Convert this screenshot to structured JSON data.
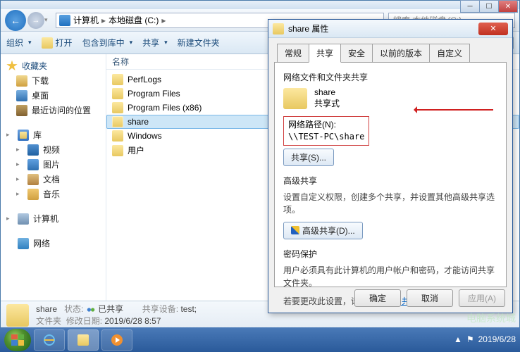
{
  "window": {
    "min_glyph": "─",
    "max_glyph": "☐",
    "close_glyph": "✕"
  },
  "nav": {
    "back_glyph": "←",
    "fwd_glyph": "→",
    "drop_glyph": "▾",
    "breadcrumb": {
      "seg1": "计算机",
      "seg2": "本地磁盘 (C:)"
    },
    "search_placeholder": "搜索 本地磁盘 (C:)"
  },
  "toolbar": {
    "organize": "组织",
    "open": "打开",
    "include": "包含到库中",
    "share": "共享",
    "newfolder": "新建文件夹",
    "view_glyph": "☰",
    "preview_glyph": "▭",
    "help_glyph": "?"
  },
  "sidebar": {
    "favorites": "收藏夹",
    "downloads": "下载",
    "desktop": "桌面",
    "recent": "最近访问的位置",
    "libraries": "库",
    "videos": "视频",
    "pictures": "图片",
    "documents": "文档",
    "music": "音乐",
    "computer": "计算机",
    "network": "网络"
  },
  "content": {
    "col_name": "名称",
    "items": [
      {
        "name": "PerfLogs"
      },
      {
        "name": "Program Files"
      },
      {
        "name": "Program Files (x86)"
      },
      {
        "name": "share"
      },
      {
        "name": "Windows"
      },
      {
        "name": "用户"
      }
    ]
  },
  "status": {
    "name": "share",
    "type_label": "文件夹",
    "state_label": "状态:",
    "state_value": "已共享",
    "modified_label": "修改日期:",
    "modified_value": "2019/6/28 8:57",
    "sharedev_label": "共享设备:",
    "sharedev_value": "test;"
  },
  "dialog": {
    "title": "share 属性",
    "close_glyph": "✕",
    "tabs": {
      "general": "常规",
      "sharing": "共享",
      "security": "安全",
      "previous": "以前的版本",
      "custom": "自定义"
    },
    "section1_title": "网络文件和文件夹共享",
    "share_name": "share",
    "share_mode": "共享式",
    "netpath_label": "网络路径(N):",
    "netpath_value": "\\\\TEST-PC\\share",
    "share_btn": "共享(S)...",
    "section2_title": "高级共享",
    "section2_desc": "设置自定义权限，创建多个共享，并设置其他高级共享选项。",
    "adv_btn": "高级共享(D)...",
    "section3_title": "密码保护",
    "section3_desc1": "用户必须具有此计算机的用户帐户和密码，才能访问共享文件夹。",
    "section3_desc2a": "若要更改此设置，请使用",
    "section3_link": "网络和共享中心",
    "section3_desc2b": "。",
    "ok": "确定",
    "cancel": "取消",
    "apply": "应用(A)"
  },
  "taskbar": {
    "time": "2019/6/28",
    "tray_glyph_flag": "▲"
  },
  "watermark": "电脑系统城"
}
